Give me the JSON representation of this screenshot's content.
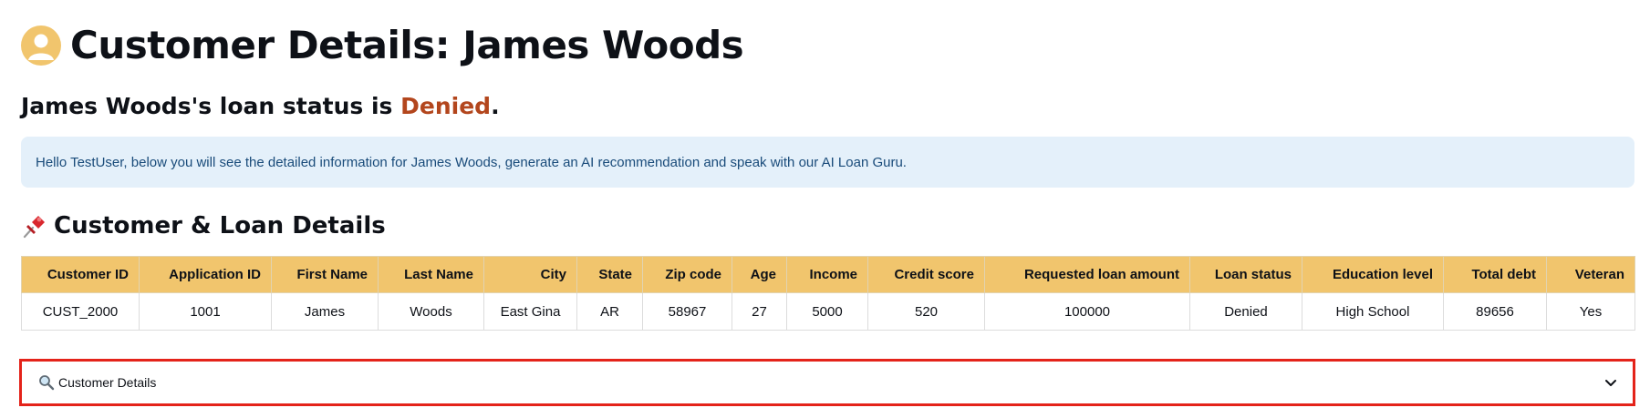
{
  "header": {
    "title": "Customer Details: James Woods",
    "avatar_icon": "user-avatar-icon",
    "avatar_color": "#f1c56d"
  },
  "status": {
    "prefix": "James Woods's loan status is ",
    "value": "Denied",
    "suffix": ".",
    "value_color": "#b3461d"
  },
  "info": {
    "message": "Hello TestUser, below you will see the detailed information for James Woods, generate an AI recommendation and speak with our AI Loan Guru."
  },
  "section": {
    "icon": "pushpin-icon",
    "title": "Customer & Loan Details"
  },
  "table": {
    "header_color": "#f1c56d",
    "columns": [
      "Customer ID",
      "Application ID",
      "First Name",
      "Last Name",
      "City",
      "State",
      "Zip code",
      "Age",
      "Income",
      "Credit score",
      "Requested loan amount",
      "Loan status",
      "Education level",
      "Total debt",
      "Veteran"
    ],
    "rows": [
      [
        "CUST_2000",
        "1001",
        "James",
        "Woods",
        "East Gina",
        "AR",
        "58967",
        "27",
        "5000",
        "520",
        "100000",
        "Denied",
        "High School",
        "89656",
        "Yes"
      ]
    ]
  },
  "expander": {
    "icon": "magnifier-icon",
    "label": "Customer Details",
    "toggle_icon": "chevron-down-icon",
    "highlight_color": "#e4231a"
  }
}
